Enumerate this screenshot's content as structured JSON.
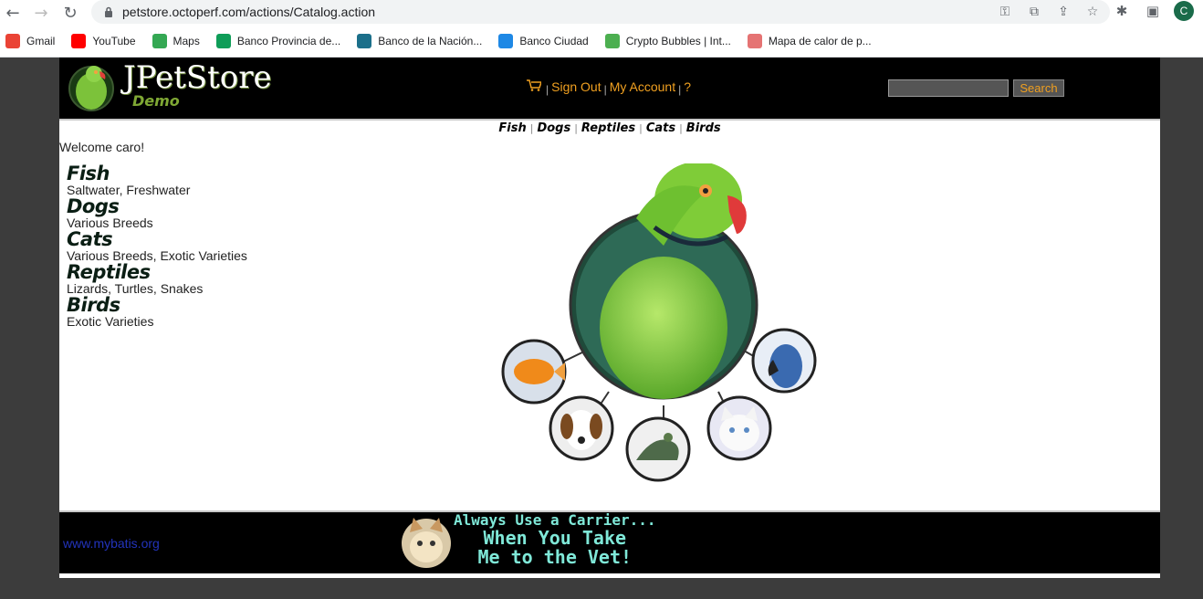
{
  "browser": {
    "url": "petstore.octoperf.com/actions/Catalog.action",
    "avatar_letter": "C",
    "bookmarks": [
      {
        "label": "Gmail",
        "icon": "gmail-icon",
        "color": "#ea4335"
      },
      {
        "label": "YouTube",
        "icon": "youtube-icon",
        "color": "#ff0000"
      },
      {
        "label": "Maps",
        "icon": "maps-icon",
        "color": "#34a853"
      },
      {
        "label": "Banco Provincia de...",
        "icon": "bank-provincia-icon",
        "color": "#0f9d58"
      },
      {
        "label": "Banco de la Nación...",
        "icon": "bank-nacion-icon",
        "color": "#1b6f8a"
      },
      {
        "label": "Banco Ciudad",
        "icon": "bank-ciudad-icon",
        "color": "#1e88e5"
      },
      {
        "label": "Crypto Bubbles | Int...",
        "icon": "crypto-bubbles-icon",
        "color": "#4caf50"
      },
      {
        "label": "Mapa de calor de p...",
        "icon": "heatmap-icon",
        "color": "#e57373"
      }
    ]
  },
  "header": {
    "logo_title": "JPetStore",
    "logo_subtitle": "Demo",
    "sign_out": "Sign Out",
    "my_account": "My Account",
    "help": "?",
    "search_button": "Search",
    "search_value": ""
  },
  "quicklinks": [
    "Fish",
    "Dogs",
    "Reptiles",
    "Cats",
    "Birds"
  ],
  "welcome": "Welcome caro!",
  "categories": [
    {
      "name": "Fish",
      "desc": "Saltwater, Freshwater"
    },
    {
      "name": "Dogs",
      "desc": "Various Breeds"
    },
    {
      "name": "Cats",
      "desc": "Various Breeds, Exotic Varieties"
    },
    {
      "name": "Reptiles",
      "desc": "Lizards, Turtles, Snakes"
    },
    {
      "name": "Birds",
      "desc": "Exotic Varieties"
    }
  ],
  "footer": {
    "link": "www.mybatis.org",
    "banner_line1": "Always Use a Carrier...",
    "banner_line2": "When You Take",
    "banner_line3": "Me to the Vet!"
  },
  "colors": {
    "accent": "#f0a020",
    "header_bg": "#000000",
    "link_blue": "#2233bb",
    "banner_text": "#7fe8d8",
    "logo_green": "#7fa834"
  }
}
